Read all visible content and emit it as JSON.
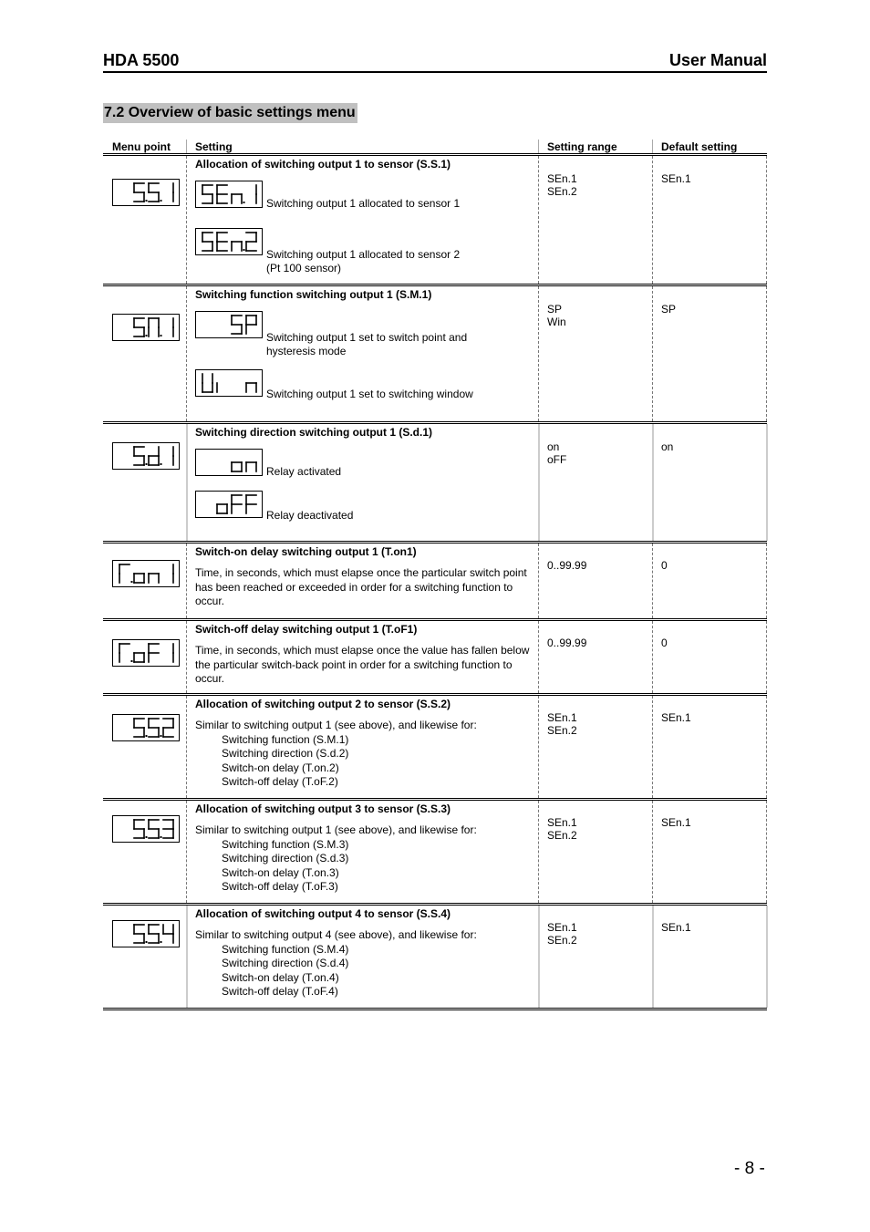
{
  "header": {
    "product": "HDA 5500",
    "doc_type": "User Manual"
  },
  "section_title": "7.2 Overview of basic settings menu",
  "table": {
    "columns": [
      "Menu point",
      "Setting",
      "Setting range",
      "Default setting"
    ],
    "rows": [
      {
        "menu_display": "S.S.1",
        "title": "Allocation of switching output 1 to sensor (S.S.1)",
        "options": [
          {
            "display": "SEn.1",
            "desc": [
              "Switching output 1 allocated to sensor 1"
            ]
          },
          {
            "display": "SEn.2",
            "desc": [
              "Switching output 1 allocated to sensor 2",
              "(Pt 100 sensor)"
            ]
          }
        ],
        "range": [
          "SEn.1",
          "SEn.2"
        ],
        "default": "SEn.1"
      },
      {
        "menu_display": "S.M.1",
        "title": "Switching function switching output 1 (S.M.1)",
        "options": [
          {
            "display": "SP",
            "desc": [
              "Switching output 1 set to switch point and",
              "hysteresis mode"
            ]
          },
          {
            "display": "Win",
            "desc": [
              "Switching output 1 set to switching window"
            ]
          }
        ],
        "range": [
          "SP",
          "Win"
        ],
        "default": "SP"
      },
      {
        "menu_display": "S.d.1",
        "title": "Switching direction switching output 1 (S.d.1)",
        "options": [
          {
            "display": "on",
            "desc": [
              "Relay activated"
            ]
          },
          {
            "display": "oFF",
            "desc": [
              "Relay deactivated"
            ]
          }
        ],
        "range": [
          "on",
          "oFF"
        ],
        "default": "on"
      },
      {
        "menu_display": "T.on1",
        "title": "Switch-on delay switching output 1 (T.on1)",
        "text": "Time, in seconds, which must elapse once the particular switch point has been reached or exceeded in order for a switching function to occur.",
        "range": [
          "0..99.99"
        ],
        "default": "0"
      },
      {
        "menu_display": "T.oF1",
        "title": "Switch-off delay switching output 1 (T.oF1)",
        "text": "Time, in seconds, which must elapse once the value has fallen below the particular switch-back point in order for a switching function to occur.",
        "range": [
          "0..99.99"
        ],
        "default": "0"
      },
      {
        "menu_display": "S.S.2",
        "title": "Allocation of switching output 2 to sensor (S.S.2)",
        "text": "Similar to switching output 1 (see above), and likewise for:",
        "items": [
          "Switching function (S.M.1)",
          "Switching direction (S.d.2)",
          "Switch-on delay (T.on.2)",
          "Switch-off delay (T.oF.2)"
        ],
        "range": [
          "SEn.1",
          "SEn.2"
        ],
        "default": "SEn.1"
      },
      {
        "menu_display": "S.S.3",
        "title": "Allocation of switching output 3 to sensor (S.S.3)",
        "text": "Similar to switching output 1 (see above), and likewise for:",
        "items": [
          "Switching function (S.M.3)",
          "Switching direction (S.d.3)",
          "Switch-on delay (T.on.3)",
          "Switch-off delay (T.oF.3)"
        ],
        "range": [
          "SEn.1",
          "SEn.2"
        ],
        "default": "SEn.1"
      },
      {
        "menu_display": "S.S.4",
        "title": "Allocation of switching output 4 to sensor (S.S.4)",
        "text": "Similar to switching output 4 (see above), and likewise for:",
        "items": [
          "Switching function (S.M.4)",
          "Switching direction (S.d.4)",
          "Switch-on delay (T.on.4)",
          "Switch-off delay (T.oF.4)"
        ],
        "range": [
          "SEn.1",
          "SEn.2"
        ],
        "default": "SEn.1"
      }
    ]
  },
  "page_number": "- 8 -"
}
